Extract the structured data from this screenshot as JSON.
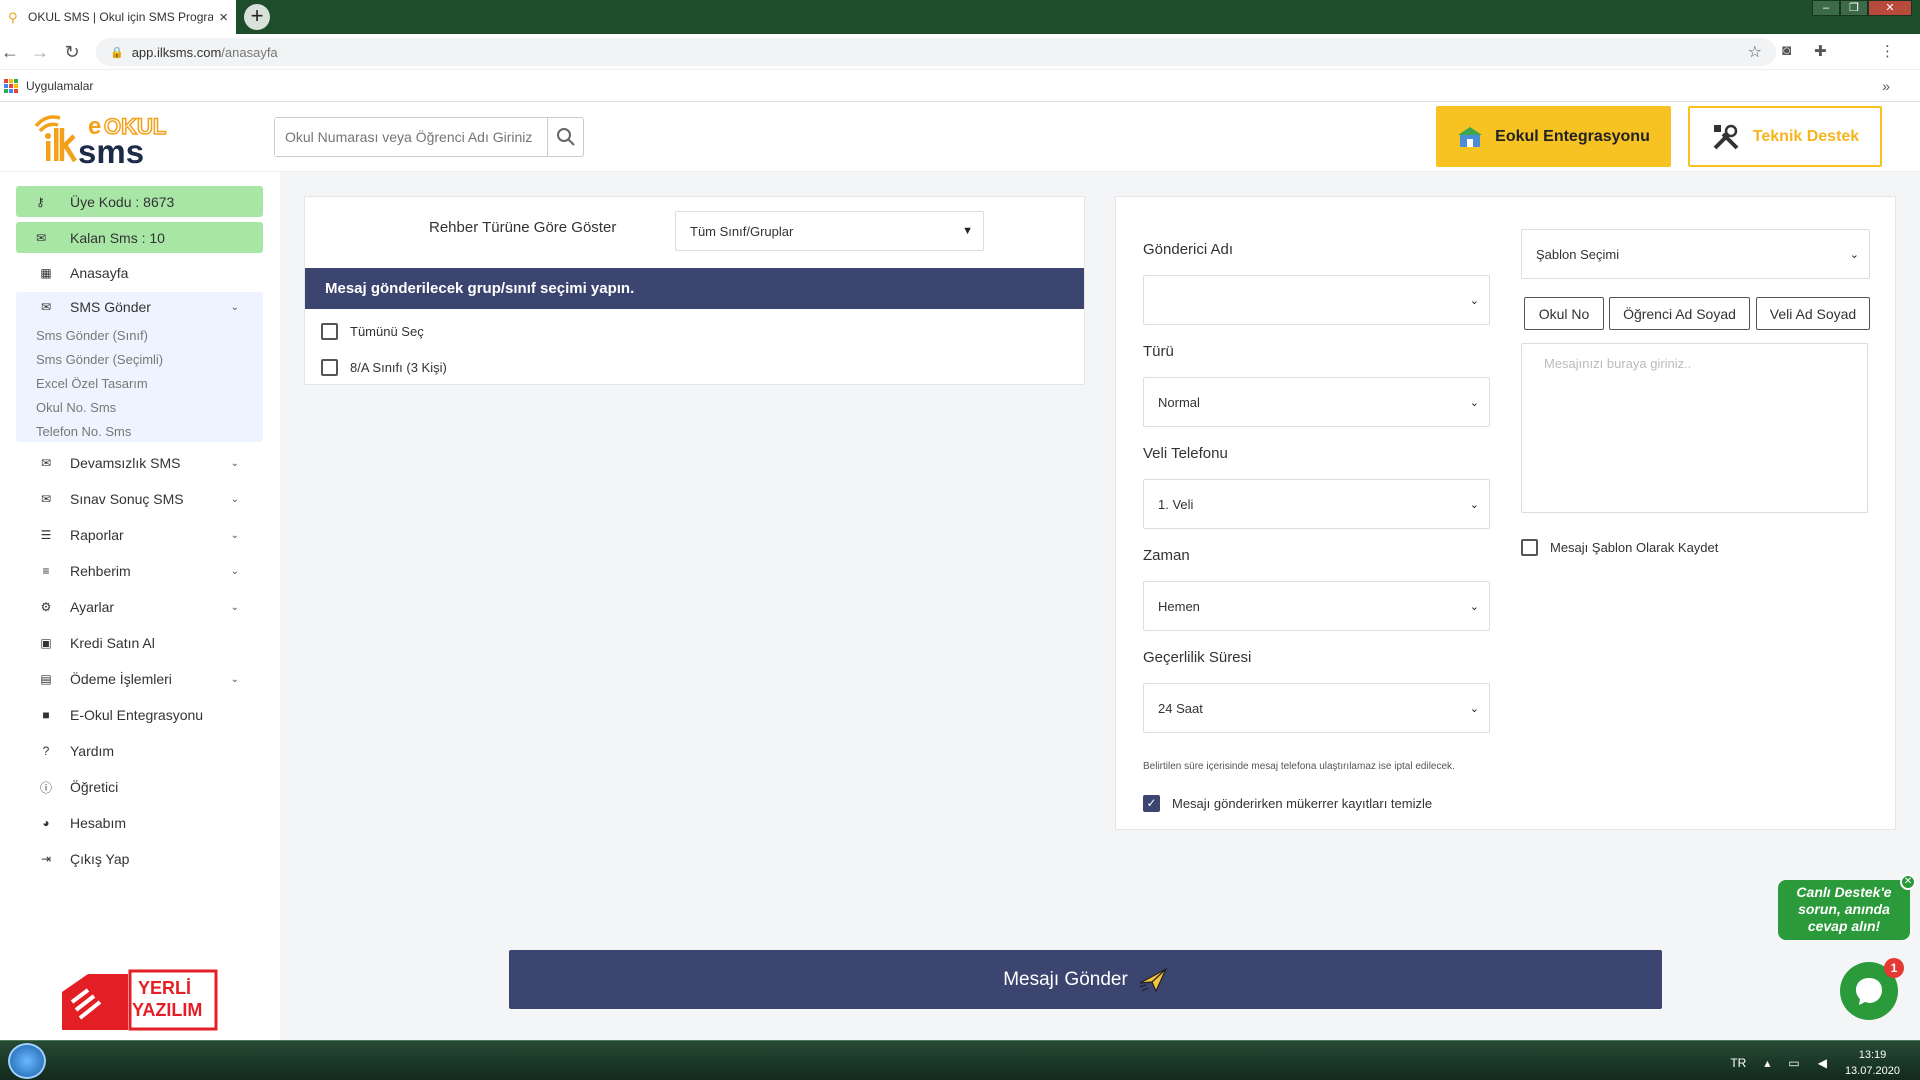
{
  "browser": {
    "tab_title": "OKUL SMS | Okul için SMS Programı",
    "tab_close": "×",
    "new_tab": "+",
    "url_host": "app.ilksms.com",
    "url_path": "/anasayfa",
    "bookmarks_label": "Uygulamalar",
    "bookmarks_more": "»"
  },
  "header": {
    "search_placeholder": "Okul Numarası veya Öğrenci Adı Giriniz",
    "eokul_button": "Eokul Entegrasyonu",
    "destek_button": "Teknik Destek"
  },
  "sidebar": {
    "uye_kodu": "Üye Kodu : 8673",
    "kalan_sms": "Kalan Sms : 10",
    "anasayfa": "Anasayfa",
    "sms_gonder": "SMS Gönder",
    "sms_sub": [
      "Sms Gönder (Sınıf)",
      "Sms Gönder (Seçimli)",
      "Excel Özel Tasarım",
      "Okul No. Sms",
      "Telefon No. Sms"
    ],
    "items": [
      {
        "label": "Devamsızlık SMS",
        "icon": "envelope-icon",
        "chevron": true
      },
      {
        "label": "Sınav Sonuç SMS",
        "icon": "envelope-icon",
        "chevron": true
      },
      {
        "label": "Raporlar",
        "icon": "list-check-icon",
        "chevron": true
      },
      {
        "label": "Rehberim",
        "icon": "list-icon",
        "chevron": true
      },
      {
        "label": "Ayarlar",
        "icon": "gear-icon",
        "chevron": true
      },
      {
        "label": "Kredi Satın Al",
        "icon": "money-icon",
        "chevron": false
      },
      {
        "label": "Ödeme İşlemleri",
        "icon": "card-icon",
        "chevron": true
      },
      {
        "label": "E-Okul Entegrasyonu",
        "icon": "folder-icon",
        "chevron": false
      },
      {
        "label": "Yardım",
        "icon": "question-icon",
        "chevron": false
      },
      {
        "label": "Öğretici",
        "icon": "info-icon",
        "chevron": false
      },
      {
        "label": "Hesabım",
        "icon": "user-circle-icon",
        "chevron": false
      },
      {
        "label": "Çıkış Yap",
        "icon": "logout-icon",
        "chevron": false
      }
    ],
    "yerli_line1": "YERLİ",
    "yerli_line2": "YAZILIM"
  },
  "left_card": {
    "rehber_label": "Rehber Türüne Göre Göster",
    "rehber_select": "Tüm Sınıf/Gruplar",
    "group_header": "Mesaj gönderilecek grup/sınıf seçimi yapın.",
    "select_all": "Tümünü Seç",
    "class_item": "8/A Sınıfı (3 Kişi)"
  },
  "right_card": {
    "gonderici_label": "Gönderici Adı",
    "gonderici_value": "",
    "turu_label": "Türü",
    "turu_value": "Normal",
    "veli_label": "Veli Telefonu",
    "veli_value": "1. Veli",
    "zaman_label": "Zaman",
    "zaman_value": "Hemen",
    "gecerlilik_label": "Geçerlilik Süresi",
    "gecerlilik_value": "24 Saat",
    "hint": "Belirtilen süre içerisinde mesaj telefona ulaştırılamaz ise iptal edilecek.",
    "mukerrer_label": "Mesajı gönderirken mükerrer kayıtları temizle",
    "sablon_select": "Şablon Seçimi",
    "var_buttons": [
      "Okul No",
      "Öğrenci Ad Soyad",
      "Veli Ad Soyad"
    ],
    "message_placeholder": "Mesajınızı buraya giriniz..",
    "sablon_save_label": "Mesajı Şablon Olarak Kaydet"
  },
  "send_button": "Mesajı Gönder",
  "chat": {
    "bubble_text": "Canlı Destek'e sorun, anında cevap alın!",
    "badge": "1"
  },
  "taskbar": {
    "lang": "TR",
    "time": "13:19",
    "date": "13.07.2020"
  }
}
